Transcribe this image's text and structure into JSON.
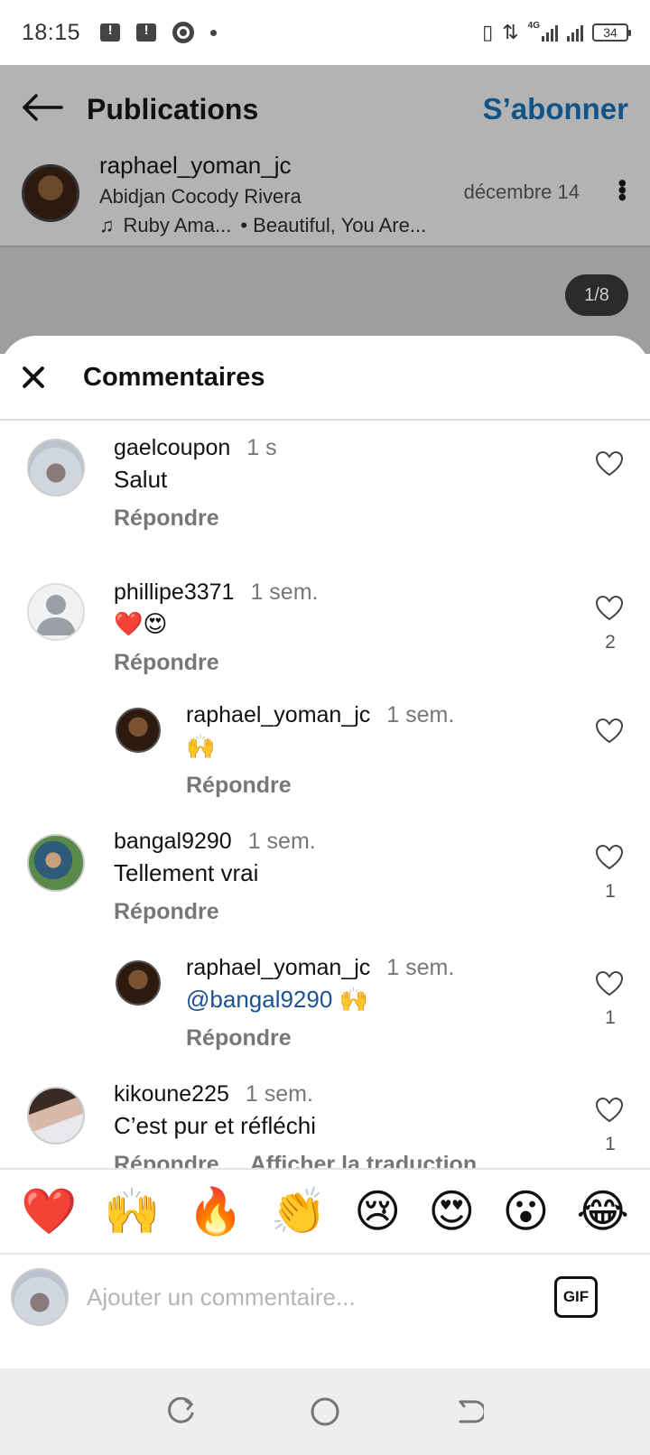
{
  "status_bar": {
    "time": "18:15",
    "network": "4G",
    "battery": "34"
  },
  "background_page": {
    "title": "Publications",
    "follow_label": "S’abonner",
    "post": {
      "username": "raphael_yoman_jc",
      "location": "Abidjan Cocody Rivera",
      "music_artist": "Ruby Ama...",
      "music_title": "• Beautiful, You Are...",
      "date": "décembre 14"
    },
    "image_counter": "1/8"
  },
  "sheet": {
    "title": "Commentaires"
  },
  "comments": [
    {
      "username": "gaelcoupon",
      "time": "1 s",
      "text": "Salut",
      "reply": "Répondre",
      "likes": ""
    },
    {
      "username": "phillipe3371",
      "time": "1 sem.",
      "text": "❤️😍",
      "reply": "Répondre",
      "likes": "2"
    },
    {
      "username": "raphael_yoman_jc",
      "time": "1 sem.",
      "text": "🙌",
      "reply": "Répondre",
      "likes": ""
    },
    {
      "username": "bangal9290",
      "time": "1 sem.",
      "text": "Tellement vrai",
      "reply": "Répondre",
      "likes": "1"
    },
    {
      "username": "raphael_yoman_jc",
      "time": "1 sem.",
      "mention": "@bangal9290",
      "text": " 🙌",
      "reply": "Répondre",
      "likes": "1"
    },
    {
      "username": "kikoune225",
      "time": "1 sem.",
      "text": "C’est pur et réfléchi",
      "reply": "Répondre",
      "translate": "Afficher la traduction",
      "likes": "1"
    }
  ],
  "emoji_bar": [
    "❤️",
    "🙌",
    "🔥",
    "👏",
    "😢",
    "😍",
    "😮",
    "😂"
  ],
  "comment_input": {
    "placeholder": "Ajouter un commentaire...",
    "gif_label": "GIF"
  },
  "icons": {
    "back": "arrow-left-icon",
    "more": "more-vertical-icon",
    "close": "close-icon",
    "like": "heart-outline-icon",
    "music": "music-note-icon"
  },
  "colors": {
    "follow_blue": "#10558a",
    "mention_blue": "#1a5294",
    "muted_text": "#777777"
  }
}
